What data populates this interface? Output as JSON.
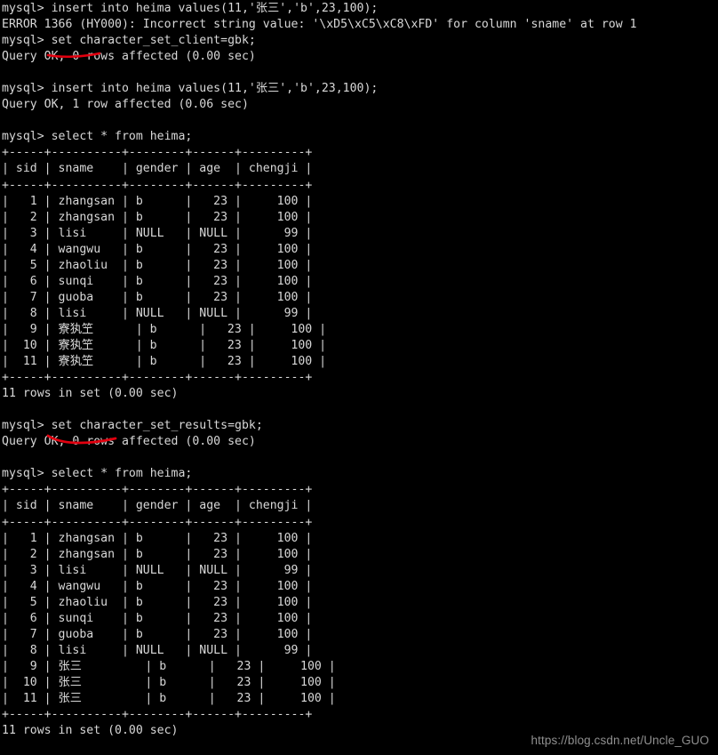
{
  "terminal": {
    "prompt": "mysql>",
    "colors": {
      "background": "#000000",
      "foreground": "#d8d8d8",
      "annotation": "#e60000",
      "watermark": "#8f8f8f"
    },
    "lines": [
      "mysql> insert into heima values(11,'张三','b',23,100);",
      "ERROR 1366 (HY000): Incorrect string value: '\\xD5\\xC5\\xC8\\xFD' for column 'sname' at row 1",
      "mysql> set character_set_client=gbk;",
      "Query OK, 0 rows affected (0.00 sec)",
      "",
      "mysql> insert into heima values(11,'张三','b',23,100);",
      "Query OK, 1 row affected (0.06 sec)",
      "",
      "mysql> select * from heima;",
      "+-----+----------+--------+------+---------+",
      "| sid | sname    | gender | age  | chengji |",
      "+-----+----------+--------+------+---------+",
      "|   1 | zhangsan | b      |   23 |     100 |",
      "|   2 | zhangsan | b      |   23 |     100 |",
      "|   3 | lisi     | NULL   | NULL |      99 |",
      "|   4 | wangwu   | b      |   23 |     100 |",
      "|   5 | zhaoliu  | b      |   23 |     100 |",
      "|   6 | sunqi    | b      |   23 |     100 |",
      "|   7 | guoba    | b      |   23 |     100 |",
      "|   8 | lisi     | NULL   | NULL |      99 |",
      "|   9 | 寮犱笁      | b      |   23 |     100 |",
      "|  10 | 寮犱笁      | b      |   23 |     100 |",
      "|  11 | 寮犱笁      | b      |   23 |     100 |",
      "+-----+----------+--------+------+---------+",
      "11 rows in set (0.00 sec)",
      "",
      "mysql> set character_set_results=gbk;",
      "Query OK, 0 rows affected (0.00 sec)",
      "",
      "mysql> select * from heima;",
      "+-----+----------+--------+------+---------+",
      "| sid | sname    | gender | age  | chengji |",
      "+-----+----------+--------+------+---------+",
      "|   1 | zhangsan | b      |   23 |     100 |",
      "|   2 | zhangsan | b      |   23 |     100 |",
      "|   3 | lisi     | NULL   | NULL |      99 |",
      "|   4 | wangwu   | b      |   23 |     100 |",
      "|   5 | zhaoliu  | b      |   23 |     100 |",
      "|   6 | sunqi    | b      |   23 |     100 |",
      "|   7 | guoba    | b      |   23 |     100 |",
      "|   8 | lisi     | NULL   | NULL |      99 |",
      "|   9 | 张三         | b      |   23 |     100 |",
      "|  10 | 张三         | b      |   23 |     100 |",
      "|  11 | 张三         | b      |   23 |     100 |",
      "+-----+----------+--------+------+---------+",
      "11 rows in set (0.00 sec)"
    ],
    "statements": {
      "insert_sql": "insert into heima values(11,'张三','b',23,100);",
      "error_1366": "ERROR 1366 (HY000): Incorrect string value: '\\xD5\\xC5\\xC8\\xFD' for column 'sname' at row 1",
      "set_client": "set character_set_client=gbk;",
      "set_results": "set character_set_results=gbk;",
      "select_sql": "select * from heima;",
      "query_ok_0": "Query OK, 0 rows affected (0.00 sec)",
      "query_ok_1": "Query OK, 1 row affected (0.06 sec)",
      "rows_in_set": "11 rows in set (0.00 sec)"
    },
    "result_table": {
      "columns": [
        "sid",
        "sname",
        "gender",
        "age",
        "chengji"
      ],
      "separator": "+-----+----------+--------+------+---------+",
      "rows_garbled": [
        [
          "1",
          "zhangsan",
          "b",
          "23",
          "100"
        ],
        [
          "2",
          "zhangsan",
          "b",
          "23",
          "100"
        ],
        [
          "3",
          "lisi",
          "NULL",
          "NULL",
          "99"
        ],
        [
          "4",
          "wangwu",
          "b",
          "23",
          "100"
        ],
        [
          "5",
          "zhaoliu",
          "b",
          "23",
          "100"
        ],
        [
          "6",
          "sunqi",
          "b",
          "23",
          "100"
        ],
        [
          "7",
          "guoba",
          "b",
          "23",
          "100"
        ],
        [
          "8",
          "lisi",
          "NULL",
          "NULL",
          "99"
        ],
        [
          "9",
          "寮犱笁",
          "b",
          "23",
          "100"
        ],
        [
          "10",
          "寮犱笁",
          "b",
          "23",
          "100"
        ],
        [
          "11",
          "寮犱笁",
          "b",
          "23",
          "100"
        ]
      ],
      "rows_correct": [
        [
          "1",
          "zhangsan",
          "b",
          "23",
          "100"
        ],
        [
          "2",
          "zhangsan",
          "b",
          "23",
          "100"
        ],
        [
          "3",
          "lisi",
          "NULL",
          "NULL",
          "99"
        ],
        [
          "4",
          "wangwu",
          "b",
          "23",
          "100"
        ],
        [
          "5",
          "zhaoliu",
          "b",
          "23",
          "100"
        ],
        [
          "6",
          "sunqi",
          "b",
          "23",
          "100"
        ],
        [
          "7",
          "guoba",
          "b",
          "23",
          "100"
        ],
        [
          "8",
          "lisi",
          "NULL",
          "NULL",
          "99"
        ],
        [
          "9",
          "张三",
          "b",
          "23",
          "100"
        ],
        [
          "10",
          "张三",
          "b",
          "23",
          "100"
        ],
        [
          "11",
          "张三",
          "b",
          "23",
          "100"
        ]
      ],
      "row_count_label": "11 rows in set (0.00 sec)"
    }
  },
  "annotations": {
    "underline_1_target": "set character_set_client",
    "underline_2_target": "set character_set_results"
  },
  "watermark": {
    "text": "https://blog.csdn.net/Uncle_GUO"
  }
}
